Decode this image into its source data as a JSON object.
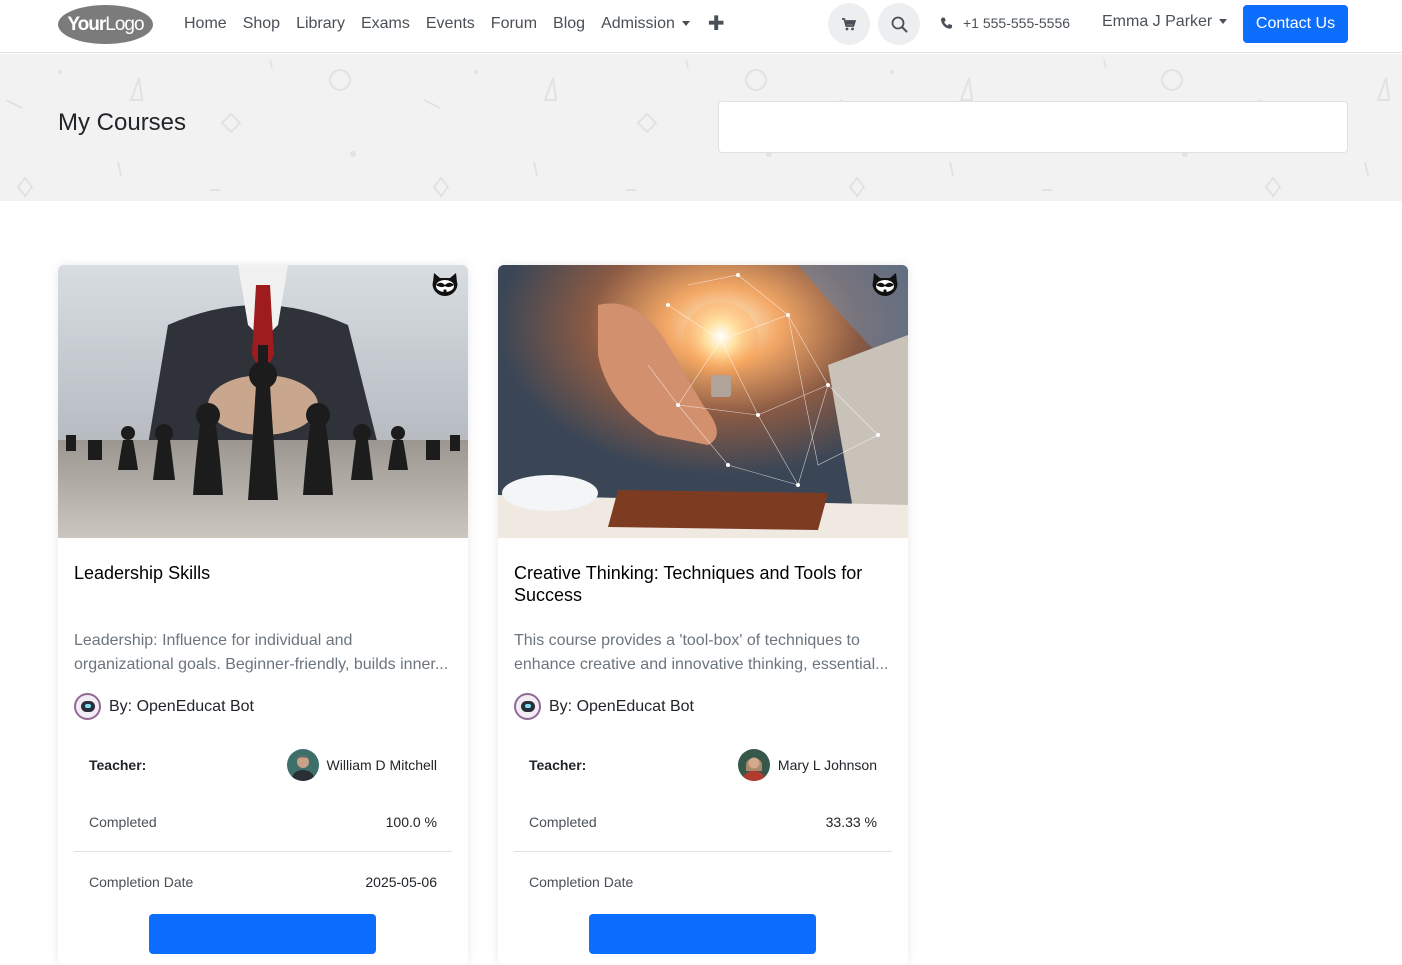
{
  "header": {
    "logo_text_bold": "Your",
    "logo_text_light": "Logo",
    "nav": [
      "Home",
      "Shop",
      "Library",
      "Exams",
      "Events",
      "Forum",
      "Blog"
    ],
    "nav_dropdown": "Admission",
    "phone": "+1 555-555-5556",
    "user_name": "Emma J Parker",
    "contact_label": "Contact Us"
  },
  "banner": {
    "title": "My Courses",
    "search_value": ""
  },
  "courses": [
    {
      "title": "Leadership Skills",
      "desc_line1": "Leadership: Influence for individual and",
      "desc_line2": "organizational goals. Beginner-friendly, builds inner...",
      "author": "By: OpenEducat Bot",
      "teacher_label": "Teacher:",
      "teacher_name": "William D Mitchell",
      "completed_label": "Completed",
      "completed_value": "100.0 %",
      "date_label": "Completion Date",
      "date_value": "2025-05-06"
    },
    {
      "title": "Creative Thinking: Techniques and Tools for Success",
      "desc_line1": "This course provides a 'tool-box' of techniques to",
      "desc_line2": "enhance creative and innovative thinking, essential...",
      "author": "By: OpenEducat Bot",
      "teacher_label": "Teacher:",
      "teacher_name": "Mary L Johnson",
      "completed_label": "Completed",
      "completed_value": "33.33 %",
      "date_label": "Completion Date",
      "date_value": ""
    }
  ],
  "colors": {
    "primary": "#0d6efd",
    "banner_bg": "#f2f2f2"
  }
}
